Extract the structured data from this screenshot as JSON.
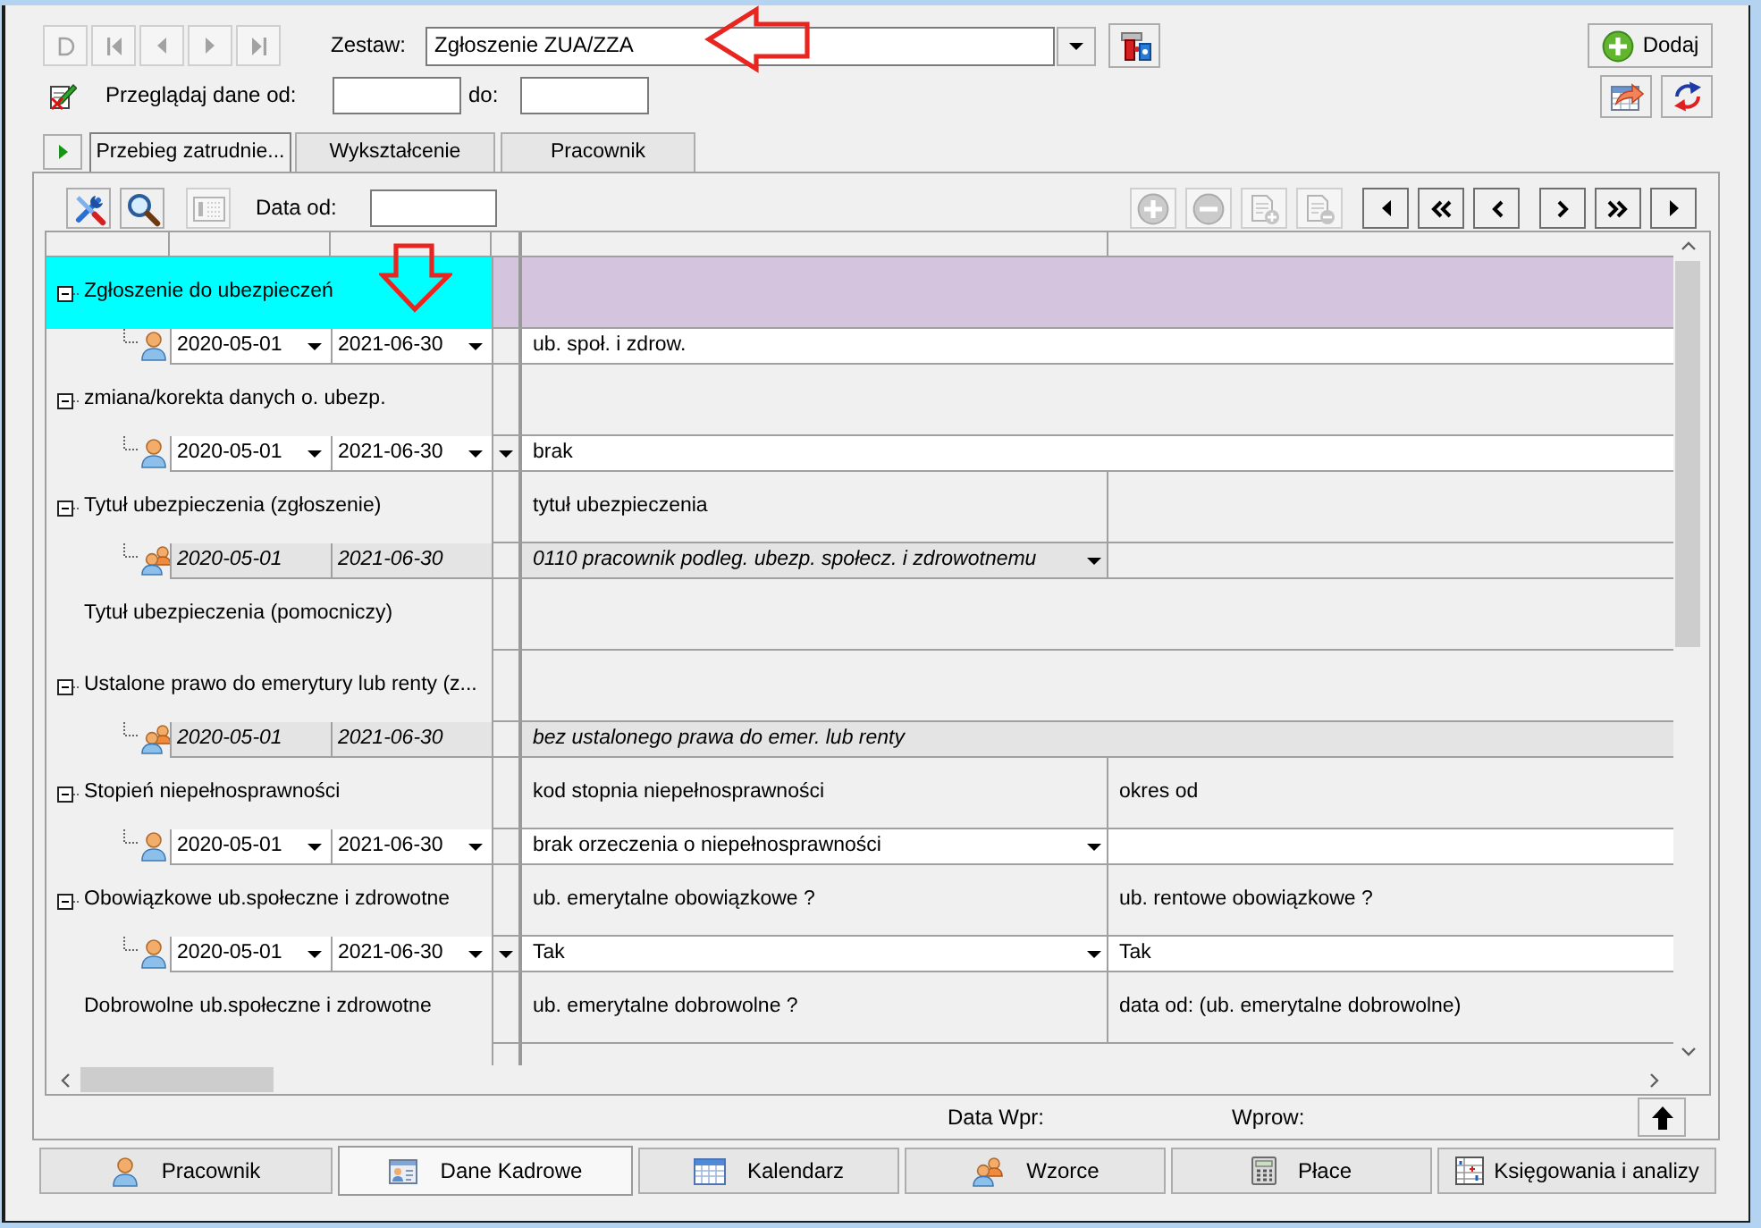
{
  "header": {
    "record_nav": {
      "disabled": true
    },
    "set_label": "Zestaw:",
    "set_value": "Zgłoszenie ZUA/ZZA",
    "add_button": "Dodaj",
    "browse_label": "Przeglądaj dane od:",
    "to_label": "do:"
  },
  "tabs": [
    {
      "label": "Przebieg zatrudnie...",
      "selected": true
    },
    {
      "label": "Wykształcenie",
      "selected": false
    },
    {
      "label": "Pracownik",
      "selected": false
    }
  ],
  "grid_toolbar": {
    "tool_buttons": [
      {
        "disabled": false
      },
      {
        "disabled": false
      },
      {
        "disabled": true
      }
    ],
    "date_label": "Data od:",
    "edit_buttons": {
      "disabled": true
    }
  },
  "grid": {
    "rows": [
      {
        "label": "Zgłoszenie do ubezpieczeń",
        "selected": true,
        "expanded": true,
        "children": [
          {
            "selected": false,
            "readonly": false,
            "date_from": "2020-05-01",
            "date_to": "2021-06-30",
            "extra_dropdown": false,
            "cells": [
              {
                "kind": "text",
                "value": "ub. społ. i zdrow."
              }
            ]
          }
        ]
      },
      {
        "label": "zmiana/korekta danych o. ubezp.",
        "selected": false,
        "expanded": true,
        "children": [
          {
            "selected": false,
            "readonly": false,
            "date_from": "2020-05-01",
            "date_to": "2021-06-30",
            "extra_dropdown": true,
            "cells": [
              {
                "kind": "text",
                "value": "brak"
              }
            ]
          }
        ]
      },
      {
        "label": "Tytuł ubezpieczenia (zgłoszenie)",
        "selected": false,
        "expanded": true,
        "cells": [
          {
            "kind": "caption",
            "value": "tytuł ubezpieczenia"
          },
          {
            "kind": "blank"
          }
        ],
        "children": [
          {
            "selected": false,
            "readonly": true,
            "date_from": "2020-05-01",
            "date_to": "2021-06-30",
            "extra_dropdown": false,
            "cells": [
              {
                "kind": "combo",
                "value": "0110 pracownik podleg. ubezp. społecz. i zdrowotnemu"
              },
              {
                "kind": "blank"
              }
            ]
          }
        ]
      },
      {
        "label": "Tytuł ubezpieczenia (pomocniczy)",
        "selected": false
      },
      {
        "label": "Ustalone prawo do emerytury lub renty (z...",
        "selected": false,
        "expanded": true,
        "children": [
          {
            "selected": false,
            "readonly": true,
            "date_from": "2020-05-01",
            "date_to": "2021-06-30",
            "extra_dropdown": false,
            "cells": [
              {
                "kind": "text",
                "value": "bez ustalonego prawa do emer. lub renty"
              }
            ]
          }
        ]
      },
      {
        "label": "Stopień niepełnosprawności",
        "selected": false,
        "expanded": true,
        "cells": [
          {
            "kind": "caption",
            "value": "kod stopnia niepełnosprawności"
          },
          {
            "kind": "caption",
            "value": "okres od"
          }
        ],
        "children": [
          {
            "selected": false,
            "readonly": false,
            "date_from": "2020-05-01",
            "date_to": "2021-06-30",
            "extra_dropdown": false,
            "cells": [
              {
                "kind": "combo",
                "value": "brak orzeczenia o niepełnosprawności"
              },
              {
                "kind": "blank"
              }
            ]
          }
        ]
      },
      {
        "label": "Obowiązkowe ub.społeczne i zdrowotne",
        "selected": false,
        "expanded": true,
        "cells": [
          {
            "kind": "caption",
            "value": "ub. emerytalne obowiązkowe ?"
          },
          {
            "kind": "caption",
            "value": "ub. rentowe obowiązkowe ?"
          }
        ],
        "children": [
          {
            "selected": false,
            "readonly": false,
            "date_from": "2020-05-01",
            "date_to": "2021-06-30",
            "extra_dropdown": true,
            "cells": [
              {
                "kind": "combo",
                "value": "Tak"
              },
              {
                "kind": "text",
                "value": "Tak"
              }
            ]
          }
        ]
      },
      {
        "label": "Dobrowolne ub.społeczne i zdrowotne",
        "selected": false,
        "cells": [
          {
            "kind": "caption",
            "value": "ub. emerytalne dobrowolne ?"
          },
          {
            "kind": "caption",
            "value": "data od: (ub. emerytalne dobrowolne)"
          }
        ]
      }
    ]
  },
  "footer": {
    "entry_date_label": "Data Wpr:",
    "entered_by_label": "Wprow:"
  },
  "module_tabs": [
    {
      "label": "Pracownik",
      "selected": false
    },
    {
      "label": "Dane Kadrowe",
      "selected": true
    },
    {
      "label": "Kalendarz",
      "selected": false
    },
    {
      "label": "Wzorce",
      "selected": false
    },
    {
      "label": "Płace",
      "selected": false
    },
    {
      "label": "Księgowania i analizy",
      "selected": false
    }
  ]
}
